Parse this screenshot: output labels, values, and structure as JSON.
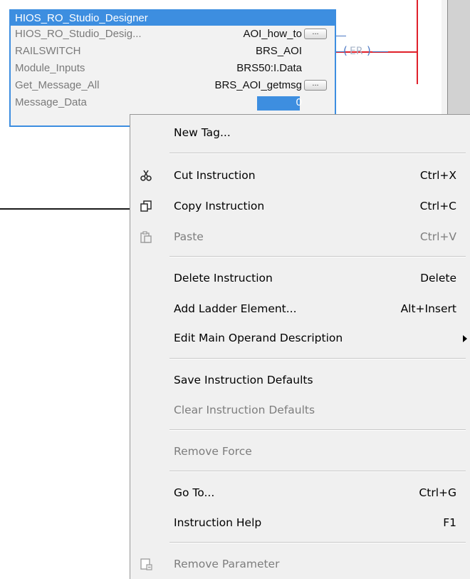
{
  "aoi": {
    "title": "HIOS_RO_Studio_Designer",
    "rows": [
      {
        "param": "HIOS_RO_Studio_Desig...",
        "value": "AOI_how_to",
        "has_ellipsis": true
      },
      {
        "param": "RAILSWITCH",
        "value": "BRS_AOI",
        "has_ellipsis": false
      },
      {
        "param": "Module_Inputs",
        "value": "BRS50:I.Data",
        "has_ellipsis": false
      },
      {
        "param": "Get_Message_All",
        "value": "BRS_AOI_getmsg",
        "has_ellipsis": true
      },
      {
        "param": "Message_Data",
        "value": "0",
        "has_ellipsis": false
      }
    ],
    "ellipsis_label": "..."
  },
  "coil": {
    "open": "(",
    "text": "ER",
    "close": ")"
  },
  "context_menu": {
    "items": [
      {
        "id": "new-tag",
        "label": "New Tag...",
        "shortcut": "",
        "enabled": true,
        "icon": ""
      },
      {
        "id": "cut-instruction",
        "label": "Cut Instruction",
        "shortcut": "Ctrl+X",
        "enabled": true,
        "icon": "scissors-icon"
      },
      {
        "id": "copy-instruction",
        "label": "Copy Instruction",
        "shortcut": "Ctrl+C",
        "enabled": true,
        "icon": "copy-icon"
      },
      {
        "id": "paste",
        "label": "Paste",
        "shortcut": "Ctrl+V",
        "enabled": false,
        "icon": "paste-icon"
      },
      {
        "id": "delete-instruction",
        "label": "Delete Instruction",
        "shortcut": "Delete",
        "enabled": true,
        "icon": ""
      },
      {
        "id": "add-ladder-element",
        "label": "Add Ladder Element...",
        "shortcut": "Alt+Insert",
        "enabled": true,
        "icon": ""
      },
      {
        "id": "edit-main-operand-description",
        "label": "Edit Main Operand Description",
        "shortcut": "",
        "enabled": true,
        "icon": "",
        "submenu": true
      },
      {
        "id": "save-instruction-defaults",
        "label": "Save Instruction Defaults",
        "shortcut": "",
        "enabled": true,
        "icon": ""
      },
      {
        "id": "clear-instruction-defaults",
        "label": "Clear Instruction Defaults",
        "shortcut": "",
        "enabled": false,
        "icon": ""
      },
      {
        "id": "remove-force",
        "label": "Remove Force",
        "shortcut": "",
        "enabled": false,
        "icon": ""
      },
      {
        "id": "go-to",
        "label": "Go To...",
        "shortcut": "Ctrl+G",
        "enabled": true,
        "icon": ""
      },
      {
        "id": "instruction-help",
        "label": "Instruction Help",
        "shortcut": "F1",
        "enabled": true,
        "icon": ""
      },
      {
        "id": "remove-parameter",
        "label": "Remove Parameter",
        "shortcut": "",
        "enabled": false,
        "icon": "remove-parameter-icon"
      }
    ]
  },
  "colors": {
    "selection_blue": "#3d8ee0",
    "rail_red": "#e0202a",
    "menu_bg": "#f0f0f0",
    "disabled_text": "#7d7d7d"
  }
}
